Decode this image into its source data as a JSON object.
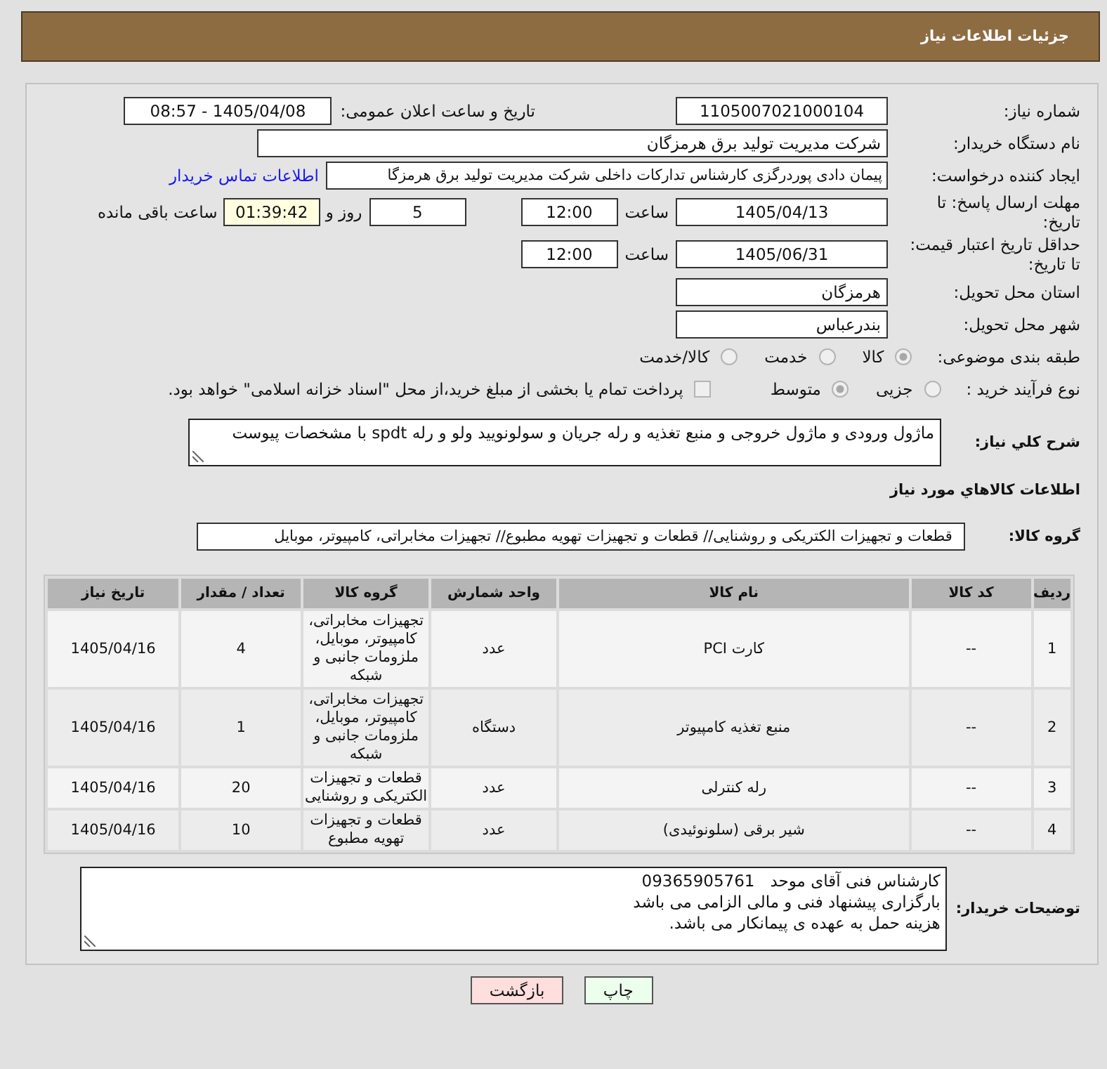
{
  "header": {
    "title": "جزئیات اطلاعات نیاز"
  },
  "need_number": {
    "label": "شماره نیاز:",
    "value": "1105007021000104"
  },
  "announcement": {
    "label": "تاریخ و ساعت اعلان عمومی:",
    "value": "1405/04/08 - 08:57"
  },
  "buyer_org": {
    "label": "نام دستگاه خریدار:",
    "value": "شرکت مدیریت تولید برق هرمزگان"
  },
  "requester": {
    "label": "ایجاد کننده درخواست:",
    "value": "پیمان دادی پوردرگزی کارشناس تدارکات داخلی شرکت مدیریت تولید برق هرمزگا",
    "contact_link": "اطلاعات تماس خریدار"
  },
  "response_deadline": {
    "label": "مهلت ارسال پاسخ: تا تاریخ:",
    "date": "1405/04/13",
    "time_label": "ساعت",
    "time": "12:00",
    "days": "5",
    "days_label": "روز و",
    "remaining": "01:39:42",
    "remaining_label": "ساعت باقی مانده"
  },
  "price_validity": {
    "label": "حداقل تاریخ اعتبار قیمت: تا تاریخ:",
    "date": "1405/06/31",
    "time_label": "ساعت",
    "time": "12:00"
  },
  "delivery_province": {
    "label": "استان محل تحویل:",
    "value": "هرمزگان"
  },
  "delivery_city": {
    "label": "شهر محل تحویل:",
    "value": "بندرعباس"
  },
  "subject_category": {
    "label": "طبقه بندی موضوعی:",
    "options": [
      {
        "label": "کالا",
        "selected": true
      },
      {
        "label": "خدمت",
        "selected": false
      },
      {
        "label": "کالا/خدمت",
        "selected": false
      }
    ]
  },
  "purchase_process": {
    "label": "نوع فرآیند خرید :",
    "options": [
      {
        "label": "جزیی",
        "selected": false
      },
      {
        "label": "متوسط",
        "selected": true
      }
    ],
    "treasury_payment": {
      "label": "پرداخت تمام یا بخشی از مبلغ خرید،از محل \"اسناد خزانه اسلامی\" خواهد بود.",
      "checked": false
    }
  },
  "description": {
    "label": "شرح کلي نیاز:",
    "value": "ماژول ورودی و ماژول خروجی و منبع تغذیه و رله جریان و سولونویید ولو و رله spdt با مشخصات پیوست"
  },
  "goods_heading": "اطلاعات کالاهاي مورد نیاز",
  "goods_group": {
    "label": "گروه کالا:",
    "value": "قطعات و تجهیزات الکتریکی و روشنایی//  قطعات و تجهیزات تهویه مطبوع// تجهیزات مخابراتی، کامپیوتر، موبایل"
  },
  "table": {
    "columns": [
      "ردیف",
      "کد کالا",
      "نام کالا",
      "واحد شمارش",
      "گروه کالا",
      "تعداد / مقدار",
      "تاریخ نیاز"
    ],
    "rows": [
      [
        "1",
        "--",
        "کارت PCI",
        "عدد",
        "تجهیزات مخابراتی، کامپیوتر، موبایل، ملزومات جانبی و شبکه",
        "4",
        "1405/04/16"
      ],
      [
        "2",
        "--",
        "منبع تغذیه کامپیوتر",
        "دستگاه",
        "تجهیزات مخابراتی، کامپیوتر، موبایل، ملزومات جانبی و شبکه",
        "1",
        "1405/04/16"
      ],
      [
        "3",
        "--",
        "رله کنترلی",
        "عدد",
        "قطعات و تجهیزات الکتریکی و روشنایی",
        "20",
        "1405/04/16"
      ],
      [
        "4",
        "--",
        "شیر برقی (سلونوئیدی)",
        "عدد",
        "قطعات و تجهیزات تهویه مطبوع",
        "10",
        "1405/04/16"
      ]
    ]
  },
  "buyer_notes": {
    "label": "توضیحات خریدار:",
    "lines": [
      "کارشناس فنی آقای موحد   09365905761",
      "بارگزاری پیشنهاد فنی و مالی الزامی می باشد",
      "هزینه حمل به عهده ی پیمانکار می باشد."
    ]
  },
  "buttons": [
    {
      "label": "چاپ",
      "kind": "print"
    },
    {
      "label": "بازگشت",
      "kind": "back"
    }
  ]
}
